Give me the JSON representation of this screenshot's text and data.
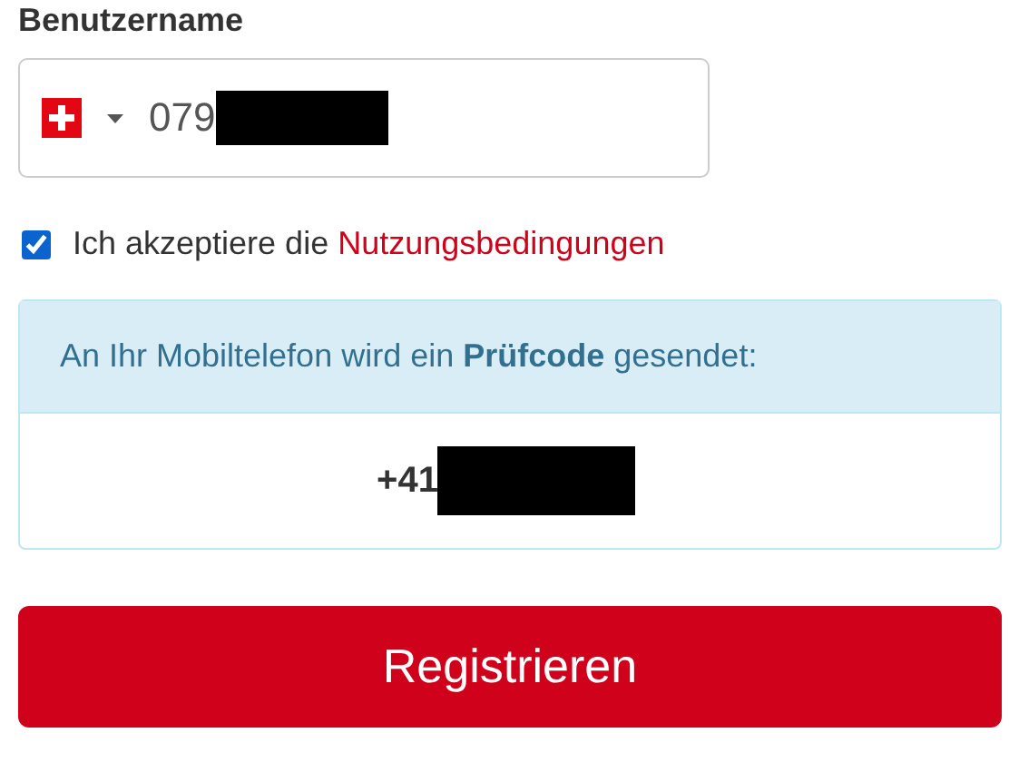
{
  "username": {
    "label": "Benutzername",
    "country_code_hidden": true,
    "value": "079"
  },
  "terms": {
    "checked": true,
    "text": "Ich akzeptiere die ",
    "link": "Nutzungsbedingungen"
  },
  "notice": {
    "message": "An Ihr Mobiltelefon wird ein **Prüfcode** gesendet:",
    "phone": "+41"
  },
  "submit": {
    "label": "Registrieren"
  }
}
